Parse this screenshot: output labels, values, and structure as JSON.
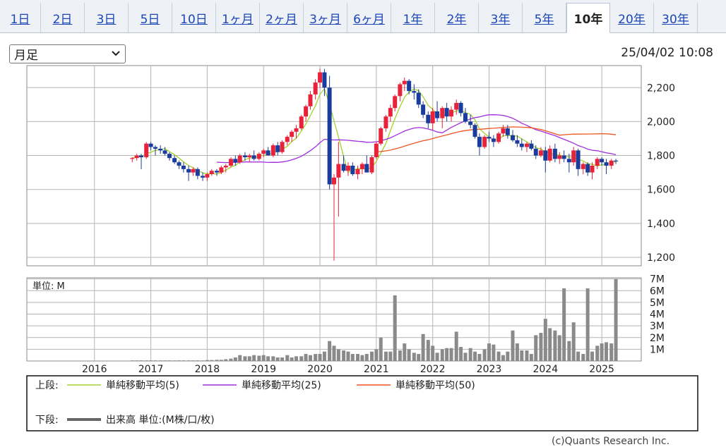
{
  "tabs": [
    {
      "label": "1日"
    },
    {
      "label": "2日"
    },
    {
      "label": "3日"
    },
    {
      "label": "5日"
    },
    {
      "label": "10日"
    },
    {
      "label": "1ヶ月"
    },
    {
      "label": "2ヶ月"
    },
    {
      "label": "3ヶ月"
    },
    {
      "label": "6ヶ月"
    },
    {
      "label": "1年"
    },
    {
      "label": "2年"
    },
    {
      "label": "3年"
    },
    {
      "label": "5年"
    },
    {
      "label": "10年"
    },
    {
      "label": "20年"
    },
    {
      "label": "30年"
    }
  ],
  "active_tab": "10年",
  "period_select": {
    "value": "月足"
  },
  "timestamp": "25/04/02 10:08",
  "copyright": "(c)Quants Research Inc.",
  "legend": {
    "upper_label": "上段:",
    "lower_label": "下段:",
    "items": [
      {
        "label": "単純移動平均(5)",
        "color": "#a3d12c"
      },
      {
        "label": "単純移動平均(25)",
        "color": "#a12ee0"
      },
      {
        "label": "単純移動平均(50)",
        "color": "#ee5522"
      }
    ],
    "volume_label": "出来高 単位:(M株/口/枚)",
    "volume_color": "#666666"
  },
  "chart_data": {
    "type": "candlestick",
    "price_axis": {
      "ylim": [
        1150,
        2330
      ],
      "ticks": [
        "2,200",
        "2,000",
        "1,800",
        "1,600",
        "1,400",
        "1,200"
      ],
      "tick_values": [
        2200,
        2000,
        1800,
        1600,
        1400,
        1200
      ],
      "position": "right"
    },
    "volume_axis": {
      "unit_label": "単位: M",
      "ylim": [
        0,
        7.1
      ],
      "ticks": [
        "7M",
        "6M",
        "5M",
        "4M",
        "3M",
        "2M",
        "1M"
      ],
      "tick_values": [
        7,
        6,
        5,
        4,
        3,
        2,
        1
      ],
      "position": "right"
    },
    "x_axis": {
      "ticks": [
        "2016",
        "2017",
        "2018",
        "2019",
        "2020",
        "2021",
        "2022",
        "2023",
        "2024",
        "2025"
      ],
      "tick_values": [
        2016,
        2017,
        2018,
        2019,
        2020,
        2021,
        2022,
        2023,
        2024,
        2025
      ],
      "xlim": [
        2014.8,
        2025.7
      ]
    },
    "grid": true,
    "up_color": "#e8223a",
    "down_color": "#1a3c9c",
    "ma_colors": {
      "ma5": "#a3d12c",
      "ma25": "#a12ee0",
      "ma50": "#ee5522"
    },
    "candles": [
      [
        2016.67,
        1780,
        1790,
        1760,
        1785
      ],
      [
        2016.75,
        1785,
        1810,
        1770,
        1800
      ],
      [
        2016.83,
        1800,
        1810,
        1720,
        1790
      ],
      [
        2016.92,
        1790,
        1880,
        1780,
        1870
      ],
      [
        2017.0,
        1870,
        1880,
        1830,
        1850
      ],
      [
        2017.08,
        1850,
        1860,
        1800,
        1840
      ],
      [
        2017.17,
        1840,
        1860,
        1810,
        1830
      ],
      [
        2017.25,
        1830,
        1850,
        1800,
        1810
      ],
      [
        2017.33,
        1810,
        1820,
        1770,
        1785
      ],
      [
        2017.42,
        1785,
        1800,
        1750,
        1760
      ],
      [
        2017.5,
        1760,
        1770,
        1720,
        1740
      ],
      [
        2017.58,
        1740,
        1760,
        1700,
        1720
      ],
      [
        2017.67,
        1720,
        1740,
        1650,
        1700
      ],
      [
        2017.75,
        1700,
        1730,
        1680,
        1720
      ],
      [
        2017.83,
        1720,
        1730,
        1660,
        1680
      ],
      [
        2017.92,
        1680,
        1700,
        1650,
        1670
      ],
      [
        2018.0,
        1670,
        1700,
        1650,
        1690
      ],
      [
        2018.08,
        1690,
        1720,
        1680,
        1710
      ],
      [
        2018.17,
        1710,
        1720,
        1680,
        1700
      ],
      [
        2018.25,
        1700,
        1740,
        1690,
        1730
      ],
      [
        2018.33,
        1730,
        1750,
        1700,
        1740
      ],
      [
        2018.42,
        1740,
        1790,
        1730,
        1780
      ],
      [
        2018.5,
        1780,
        1800,
        1740,
        1760
      ],
      [
        2018.58,
        1760,
        1810,
        1750,
        1800
      ],
      [
        2018.67,
        1800,
        1820,
        1770,
        1790
      ],
      [
        2018.75,
        1790,
        1810,
        1760,
        1800
      ],
      [
        2018.83,
        1800,
        1830,
        1770,
        1780
      ],
      [
        2018.92,
        1780,
        1820,
        1770,
        1810
      ],
      [
        2019.0,
        1810,
        1840,
        1790,
        1830
      ],
      [
        2019.08,
        1830,
        1850,
        1800,
        1800
      ],
      [
        2019.17,
        1800,
        1870,
        1790,
        1860
      ],
      [
        2019.25,
        1860,
        1880,
        1800,
        1820
      ],
      [
        2019.33,
        1820,
        1890,
        1810,
        1880
      ],
      [
        2019.42,
        1880,
        1920,
        1860,
        1910
      ],
      [
        2019.5,
        1910,
        1950,
        1880,
        1940
      ],
      [
        2019.58,
        1940,
        1980,
        1900,
        1960
      ],
      [
        2019.67,
        1960,
        2040,
        1950,
        2030
      ],
      [
        2019.75,
        2030,
        2100,
        2000,
        2090
      ],
      [
        2019.83,
        2090,
        2180,
        2070,
        2160
      ],
      [
        2019.92,
        2160,
        2250,
        2130,
        2230
      ],
      [
        2020.0,
        2230,
        2310,
        2200,
        2290
      ],
      [
        2020.08,
        2290,
        2310,
        2150,
        2200
      ],
      [
        2020.17,
        2200,
        2270,
        1600,
        1630
      ],
      [
        2020.25,
        1630,
        1690,
        1180,
        1670
      ],
      [
        2020.33,
        1670,
        1880,
        1440,
        1750
      ],
      [
        2020.42,
        1750,
        1800,
        1700,
        1710
      ],
      [
        2020.5,
        1710,
        1760,
        1680,
        1740
      ],
      [
        2020.58,
        1740,
        1760,
        1680,
        1690
      ],
      [
        2020.67,
        1690,
        1740,
        1660,
        1720
      ],
      [
        2020.75,
        1720,
        1760,
        1690,
        1750
      ],
      [
        2020.83,
        1750,
        1800,
        1700,
        1700
      ],
      [
        2020.92,
        1700,
        1800,
        1690,
        1790
      ],
      [
        2021.0,
        1790,
        1880,
        1780,
        1870
      ],
      [
        2021.08,
        1870,
        1970,
        1860,
        1960
      ],
      [
        2021.17,
        1960,
        2040,
        1940,
        2030
      ],
      [
        2021.25,
        2030,
        2100,
        2000,
        2080
      ],
      [
        2021.33,
        2080,
        2160,
        2060,
        2150
      ],
      [
        2021.42,
        2150,
        2230,
        2120,
        2220
      ],
      [
        2021.5,
        2220,
        2260,
        2180,
        2240
      ],
      [
        2021.58,
        2240,
        2250,
        2160,
        2180
      ],
      [
        2021.67,
        2180,
        2220,
        2130,
        2170
      ],
      [
        2021.75,
        2170,
        2190,
        2080,
        2100
      ],
      [
        2021.83,
        2100,
        2120,
        2020,
        2040
      ],
      [
        2021.92,
        2040,
        2060,
        1960,
        1990
      ],
      [
        2022.0,
        1990,
        2080,
        1950,
        2060
      ],
      [
        2022.08,
        2060,
        2120,
        2000,
        2020
      ],
      [
        2022.17,
        2020,
        2090,
        1960,
        2080
      ],
      [
        2022.25,
        2080,
        2110,
        2000,
        2030
      ],
      [
        2022.33,
        2030,
        2090,
        2000,
        2070
      ],
      [
        2022.42,
        2070,
        2130,
        2040,
        2110
      ],
      [
        2022.5,
        2110,
        2120,
        2030,
        2050
      ],
      [
        2022.58,
        2050,
        2080,
        1990,
        2000
      ],
      [
        2022.67,
        2000,
        2040,
        1960,
        1980
      ],
      [
        2022.75,
        1980,
        1990,
        1900,
        1910
      ],
      [
        2022.83,
        1910,
        1930,
        1800,
        1850
      ],
      [
        2022.92,
        1850,
        1920,
        1840,
        1910
      ],
      [
        2023.0,
        1910,
        1940,
        1880,
        1900
      ],
      [
        2023.08,
        1900,
        1920,
        1850,
        1880
      ],
      [
        2023.17,
        1880,
        1940,
        1870,
        1930
      ],
      [
        2023.25,
        1930,
        1980,
        1910,
        1960
      ],
      [
        2023.33,
        1960,
        1980,
        1900,
        1920
      ],
      [
        2023.42,
        1920,
        1950,
        1880,
        1890
      ],
      [
        2023.5,
        1890,
        1920,
        1850,
        1870
      ],
      [
        2023.58,
        1870,
        1900,
        1830,
        1850
      ],
      [
        2023.67,
        1850,
        1880,
        1820,
        1870
      ],
      [
        2023.75,
        1870,
        1890,
        1830,
        1840
      ],
      [
        2023.83,
        1840,
        1860,
        1780,
        1800
      ],
      [
        2023.92,
        1800,
        1850,
        1790,
        1830
      ],
      [
        2024.0,
        1830,
        1850,
        1700,
        1770
      ],
      [
        2024.08,
        1770,
        1860,
        1760,
        1840
      ],
      [
        2024.17,
        1840,
        1870,
        1760,
        1780
      ],
      [
        2024.25,
        1780,
        1820,
        1750,
        1800
      ],
      [
        2024.33,
        1800,
        1830,
        1760,
        1780
      ],
      [
        2024.42,
        1780,
        1810,
        1700,
        1760
      ],
      [
        2024.5,
        1760,
        1850,
        1740,
        1830
      ],
      [
        2024.58,
        1830,
        1840,
        1680,
        1720
      ],
      [
        2024.67,
        1720,
        1760,
        1690,
        1750
      ],
      [
        2024.75,
        1750,
        1760,
        1680,
        1700
      ],
      [
        2024.83,
        1700,
        1760,
        1660,
        1740
      ],
      [
        2024.92,
        1740,
        1790,
        1720,
        1780
      ],
      [
        2025.0,
        1780,
        1790,
        1740,
        1760
      ],
      [
        2025.08,
        1760,
        1780,
        1690,
        1740
      ],
      [
        2025.17,
        1740,
        1780,
        1720,
        1770
      ],
      [
        2025.25,
        1770,
        1780,
        1750,
        1765
      ]
    ],
    "volume": [
      [
        2016.67,
        0.05
      ],
      [
        2016.75,
        0.05
      ],
      [
        2016.83,
        0.05
      ],
      [
        2016.92,
        0.05
      ],
      [
        2017.0,
        0.05
      ],
      [
        2017.08,
        0.05
      ],
      [
        2017.17,
        0.05
      ],
      [
        2017.25,
        0.05
      ],
      [
        2017.33,
        0.05
      ],
      [
        2017.42,
        0.05
      ],
      [
        2017.5,
        0.05
      ],
      [
        2017.58,
        0.05
      ],
      [
        2017.67,
        0.05
      ],
      [
        2017.75,
        0.05
      ],
      [
        2017.83,
        0.05
      ],
      [
        2017.92,
        0.05
      ],
      [
        2018.0,
        0.08
      ],
      [
        2018.08,
        0.08
      ],
      [
        2018.17,
        0.1
      ],
      [
        2018.25,
        0.1
      ],
      [
        2018.33,
        0.15
      ],
      [
        2018.42,
        0.2
      ],
      [
        2018.5,
        0.3
      ],
      [
        2018.58,
        0.5
      ],
      [
        2018.67,
        0.4
      ],
      [
        2018.75,
        0.4
      ],
      [
        2018.83,
        0.5
      ],
      [
        2018.92,
        0.45
      ],
      [
        2019.0,
        0.5
      ],
      [
        2019.08,
        0.4
      ],
      [
        2019.17,
        0.4
      ],
      [
        2019.25,
        0.3
      ],
      [
        2019.33,
        0.3
      ],
      [
        2019.42,
        0.5
      ],
      [
        2019.5,
        0.3
      ],
      [
        2019.58,
        0.4
      ],
      [
        2019.67,
        0.4
      ],
      [
        2019.75,
        0.6
      ],
      [
        2019.83,
        0.5
      ],
      [
        2019.92,
        0.6
      ],
      [
        2020.0,
        0.6
      ],
      [
        2020.08,
        0.8
      ],
      [
        2020.17,
        1.7
      ],
      [
        2020.25,
        1.3
      ],
      [
        2020.33,
        1.0
      ],
      [
        2020.42,
        0.9
      ],
      [
        2020.5,
        0.8
      ],
      [
        2020.58,
        0.6
      ],
      [
        2020.67,
        0.6
      ],
      [
        2020.75,
        0.5
      ],
      [
        2020.83,
        0.6
      ],
      [
        2020.92,
        0.8
      ],
      [
        2021.0,
        1.0
      ],
      [
        2021.08,
        2.0
      ],
      [
        2021.17,
        0.8
      ],
      [
        2021.25,
        0.8
      ],
      [
        2021.33,
        5.6
      ],
      [
        2021.42,
        0.9
      ],
      [
        2021.5,
        1.5
      ],
      [
        2021.58,
        1.0
      ],
      [
        2021.67,
        0.7
      ],
      [
        2021.75,
        0.6
      ],
      [
        2021.83,
        2.3
      ],
      [
        2021.92,
        1.8
      ],
      [
        2022.0,
        1.3
      ],
      [
        2022.08,
        0.7
      ],
      [
        2022.17,
        1.0
      ],
      [
        2022.25,
        1.1
      ],
      [
        2022.33,
        1.1
      ],
      [
        2022.42,
        2.5
      ],
      [
        2022.5,
        1.2
      ],
      [
        2022.58,
        0.7
      ],
      [
        2022.67,
        1.1
      ],
      [
        2022.75,
        0.8
      ],
      [
        2022.83,
        0.6
      ],
      [
        2022.92,
        1.0
      ],
      [
        2023.0,
        1.5
      ],
      [
        2023.08,
        1.4
      ],
      [
        2023.17,
        0.8
      ],
      [
        2023.25,
        0.5
      ],
      [
        2023.33,
        0.8
      ],
      [
        2023.42,
        2.6
      ],
      [
        2023.5,
        1.5
      ],
      [
        2023.58,
        0.9
      ],
      [
        2023.67,
        0.9
      ],
      [
        2023.75,
        0.6
      ],
      [
        2023.83,
        2.2
      ],
      [
        2023.92,
        2.4
      ],
      [
        2024.0,
        3.6
      ],
      [
        2024.08,
        2.8
      ],
      [
        2024.17,
        2.6
      ],
      [
        2024.25,
        2.2
      ],
      [
        2024.33,
        6.2
      ],
      [
        2024.42,
        1.7
      ],
      [
        2024.5,
        3.3
      ],
      [
        2024.58,
        0.8
      ],
      [
        2024.67,
        0.6
      ],
      [
        2024.75,
        6.2
      ],
      [
        2024.83,
        0.8
      ],
      [
        2024.92,
        1.3
      ],
      [
        2025.0,
        1.5
      ],
      [
        2025.08,
        1.6
      ],
      [
        2025.17,
        1.5
      ],
      [
        2025.25,
        7.0
      ]
    ]
  }
}
